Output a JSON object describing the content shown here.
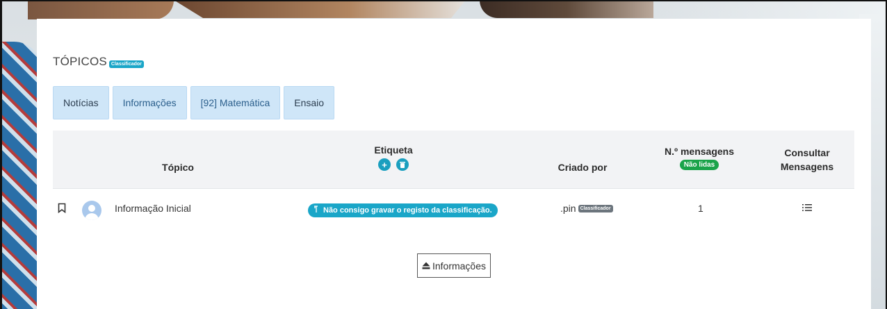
{
  "header": {
    "title": "TÓPICOS",
    "badge": "Classificador"
  },
  "tabs": [
    {
      "label": "Notícias"
    },
    {
      "label": "Informações"
    },
    {
      "label": "[92] Matemática"
    },
    {
      "label": "Ensaio"
    }
  ],
  "table": {
    "columns": {
      "topico": "Tópico",
      "etiqueta": "Etiqueta",
      "criado_por": "Criado por",
      "mensagens": "N.º mensagens",
      "mensagens_badge": "Não lidas",
      "consultar_line1": "Consultar",
      "consultar_line2": "Mensagens"
    },
    "rows": [
      {
        "topico": "Informação Inicial",
        "etiqueta": "Não consigo gravar o registo da classificação.",
        "criado_por": ".pin",
        "criado_por_badge": "Classificador",
        "mensagens": "1"
      }
    ]
  },
  "footer": {
    "info_button": "Informações"
  },
  "colors": {
    "tab_bg": "#cfe6f8",
    "badge_info": "#1aa6c8",
    "badge_green": "#1aa34a",
    "header_bg": "#f2f3f5"
  },
  "icons": {
    "add_label": "plus-circle-icon",
    "delete_label": "trash-circle-icon",
    "bookmark": "bookmark-icon",
    "avatar": "user-avatar-icon",
    "tag": "tag-icon",
    "list": "list-icon",
    "eject": "eject-icon"
  }
}
